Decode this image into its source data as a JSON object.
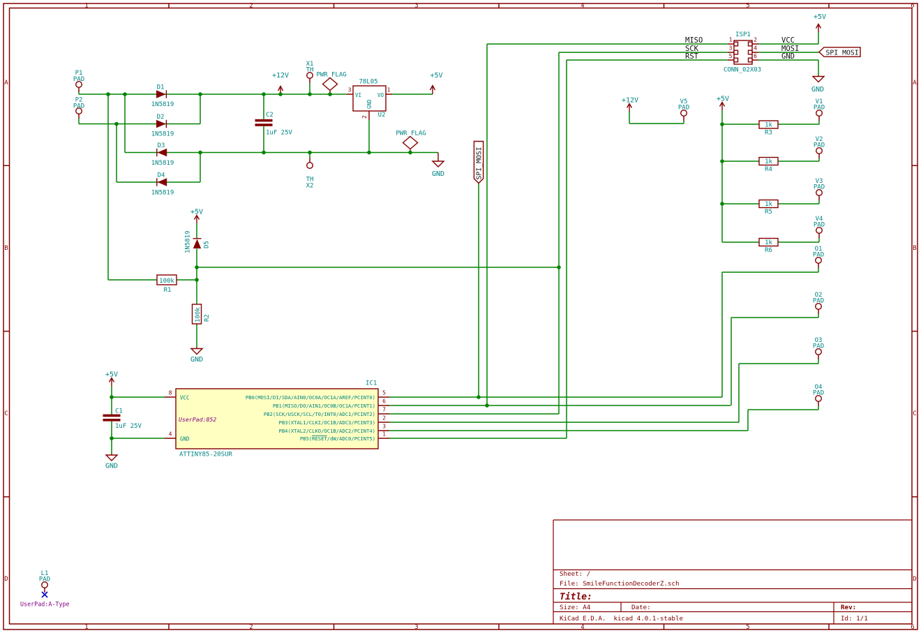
{
  "frame": {
    "columns": [
      "1",
      "2",
      "3",
      "4",
      "5",
      "6"
    ],
    "rows": [
      "A",
      "B",
      "C",
      "D"
    ]
  },
  "power": {
    "p5v": "+5V",
    "p12v": "+12V",
    "gnd": "GND",
    "pwr_flag": "PWR_FLAG"
  },
  "net": {
    "spi_mosi": "SPI_MOSI"
  },
  "pads": {
    "p1": {
      "ref": "P1",
      "value": "PAD"
    },
    "p2": {
      "ref": "P2",
      "value": "PAD"
    },
    "x1": {
      "ref": "X1",
      "value": "TH"
    },
    "x2": {
      "ref": "X2",
      "value": "TH"
    },
    "v1": {
      "ref": "V1",
      "value": "PAD"
    },
    "v2": {
      "ref": "V2",
      "value": "PAD"
    },
    "v3": {
      "ref": "V3",
      "value": "PAD"
    },
    "v4": {
      "ref": "V4",
      "value": "PAD"
    },
    "v5": {
      "ref": "V5",
      "value": "PAD"
    },
    "o1": {
      "ref": "O1",
      "value": "PAD"
    },
    "o2": {
      "ref": "O2",
      "value": "PAD"
    },
    "o3": {
      "ref": "O3",
      "value": "PAD"
    },
    "o4": {
      "ref": "O4",
      "value": "PAD"
    },
    "l1": {
      "ref": "L1",
      "value": "PAD",
      "field": "UserPad:A-Type"
    }
  },
  "diodes": {
    "d1": {
      "ref": "D1",
      "value": "1N5819"
    },
    "d2": {
      "ref": "D2",
      "value": "1N5819"
    },
    "d3": {
      "ref": "D3",
      "value": "1N5819"
    },
    "d4": {
      "ref": "D4",
      "value": "1N5819"
    },
    "d5": {
      "ref": "D5",
      "value": "1N5819"
    }
  },
  "resistors": {
    "r1": {
      "ref": "R1",
      "value": "100k"
    },
    "r2": {
      "ref": "R2",
      "value": "100k"
    },
    "r3": {
      "ref": "R3",
      "value": "1k"
    },
    "r4": {
      "ref": "R4",
      "value": "1k"
    },
    "r5": {
      "ref": "R5",
      "value": "1k"
    },
    "r6": {
      "ref": "R6",
      "value": "1k"
    }
  },
  "capacitors": {
    "c1": {
      "ref": "C1",
      "value": "1uF 25V"
    },
    "c2": {
      "ref": "C2",
      "value": "1uF 25V"
    }
  },
  "regulator": {
    "ref": "U2",
    "value": "78L05",
    "pin_vi": "VI",
    "pin_vo": "VO",
    "pin_gnd": "GND",
    "num_vi": "3",
    "num_vo": "1",
    "num_gnd": "2"
  },
  "mcu": {
    "ref": "IC1",
    "value": "ATTINY85-20SUR",
    "field": "UserPad:852",
    "pin_vcc": "VCC",
    "num_vcc": "8",
    "pin_gnd": "GND",
    "num_gnd": "4",
    "pins_right": [
      {
        "name": "PB0(MOSI/DI/SDA/AIN0/OC0A/OC1A/AREF/PCINT0)",
        "num": "5"
      },
      {
        "name": "PB1(MISO/DO/AIN1/OC0B/OC1A/PCINT1)",
        "num": "6"
      },
      {
        "name": "PB2(SCK/USCK/SCL/T0/INT0/ADC1/PCINT2)",
        "num": "7"
      },
      {
        "name": "PB3(XTAL1/CLKI/OC1B/ADC3/PCINT3)",
        "num": "2"
      },
      {
        "name": "PB4(XTAL2/CLKO/OC1B/ADC2/PCINT4)",
        "num": "3"
      },
      {
        "name": "PB5(RESET/dW/ADC0/PCINT5)",
        "num": "1"
      }
    ]
  },
  "isp": {
    "ref": "ISP1",
    "value": "CONN_02X03",
    "left": [
      {
        "num": "1",
        "label": "MISO"
      },
      {
        "num": "3",
        "label": "SCK"
      },
      {
        "num": "5",
        "label": "RST"
      }
    ],
    "right": [
      {
        "num": "2",
        "label": "VCC"
      },
      {
        "num": "4",
        "label": "MOSI"
      },
      {
        "num": "6",
        "label": "GND"
      }
    ]
  },
  "title_block": {
    "sheet": "Sheet: /",
    "file": "File: SmileFunctionDecoderZ.sch",
    "title": "Title:",
    "size": "Size: A4",
    "date": "Date:",
    "rev": "Rev:",
    "generator": "KiCad E.D.A.  kicad 4.0.1-stable",
    "id": "Id: 1/1"
  },
  "colors": {
    "wire": "#008400",
    "component": "#840000",
    "annotation": "#008484",
    "field": "#840084",
    "noconnect": "#0000c2",
    "ic_fill": "#ffffc2"
  }
}
